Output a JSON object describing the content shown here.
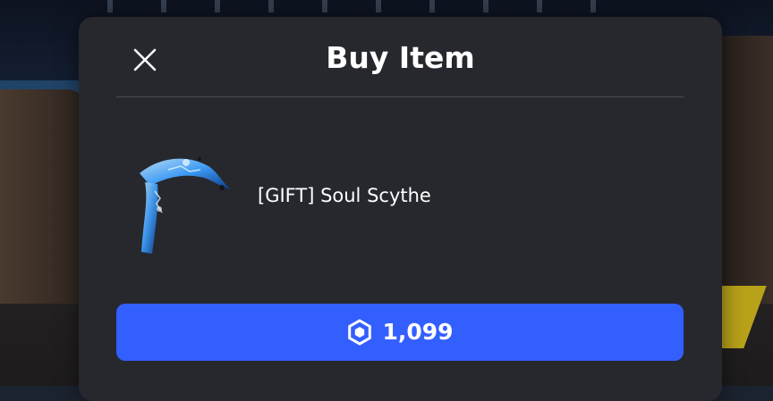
{
  "modal": {
    "title": "Buy Item",
    "close_icon": "close-icon"
  },
  "item": {
    "name": "[GIFT] Soul Scythe",
    "thumbnail_icon": "soul-scythe-thumbnail"
  },
  "purchase": {
    "currency_icon": "robux-icon",
    "price": "1,099",
    "button_color": "#335fff"
  },
  "colors": {
    "modal_bg": "#26282e",
    "text": "#ffffff"
  }
}
